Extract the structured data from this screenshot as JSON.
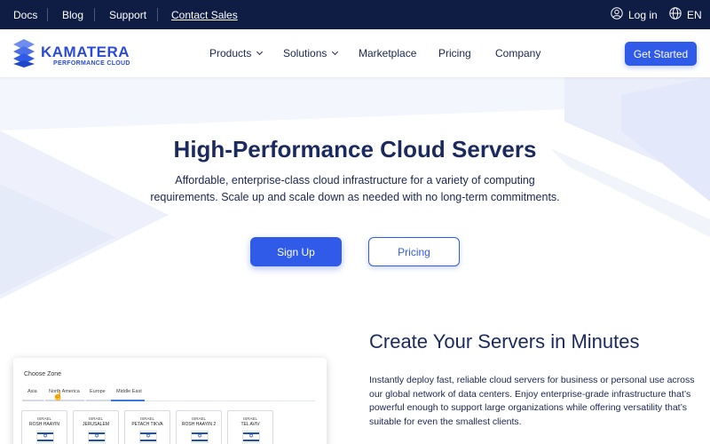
{
  "topbar": {
    "links": [
      "Docs",
      "Blog",
      "Support",
      "Contact Sales"
    ],
    "login": "Log in",
    "language": "EN"
  },
  "header": {
    "logo_main": "KAMATERA",
    "logo_sub": "PERFORMANCE CLOUD",
    "nav": [
      "Products",
      "Solutions",
      "Marketplace",
      "Pricing",
      "Company"
    ],
    "cta": "Get Started"
  },
  "hero": {
    "title": "High-Performance Cloud Servers",
    "subtitle": "Affordable, enterprise-class cloud infrastructure for a variety of computing requirements. Scale up and scale down as needed with no long-term commitments.",
    "primary_button": "Sign Up",
    "secondary_button": "Pricing"
  },
  "zones": {
    "title": "Choose Zone",
    "tabs": [
      "Asia",
      "North America",
      "Europe",
      "Middle East"
    ],
    "active_tab": "Middle East",
    "locations": [
      {
        "country": "ISRAEL",
        "city": "ROSH HAAYIN"
      },
      {
        "country": "ISRAEL",
        "city": "JERUSALEM"
      },
      {
        "country": "ISRAEL",
        "city": "PETACH TIKVA"
      },
      {
        "country": "ISRAEL",
        "city": "ROSH HAAYIN 2"
      },
      {
        "country": "ISRAEL",
        "city": "TEL AVIV"
      }
    ]
  },
  "section": {
    "title": "Create Your Servers in Minutes",
    "body": "Instantly deploy fast, reliable cloud servers for business or personal use across our global network of data centers. Enjoy enterprise-grade infrastructure that’s powerful enough to support large organizations while offering versatility that’s suitable for even the smallest clients."
  },
  "colors": {
    "topbar_bg": "#0f1d45",
    "accent": "#2f5be8",
    "heading": "#1b2a5e"
  }
}
